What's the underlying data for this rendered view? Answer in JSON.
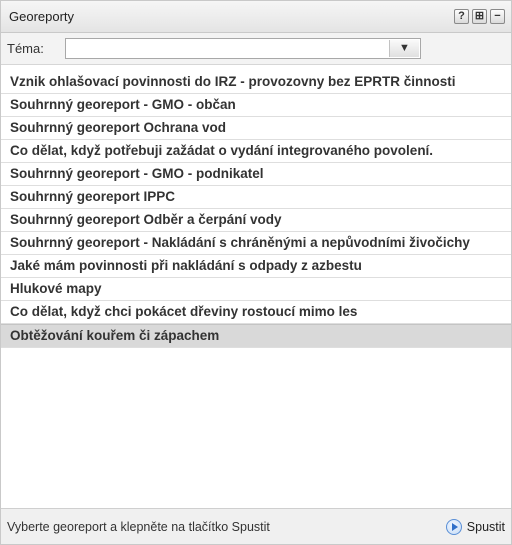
{
  "header": {
    "title": "Georeporty",
    "help": "?",
    "pin": "⊞",
    "collapse": "−"
  },
  "filter": {
    "label": "Téma:",
    "value": ""
  },
  "items": [
    "Vznik ohlašovací povinnosti do IRZ - provozovny bez EPRTR činnosti",
    "Souhrnný georeport - GMO - občan",
    "Souhrnný georeport Ochrana vod",
    "Co dělat, když potřebuji zažádat o vydání integrovaného povolení.",
    "Souhrnný georeport - GMO - podnikatel",
    "Souhrnný georeport IPPC",
    "Souhrnný georeport Odběr a čerpání vody",
    "Souhrnný georeport - Nakládání s chráněnými a nepůvodními živočichy",
    "Jaké mám povinnosti při nakládání s odpady z azbestu",
    "Hlukové mapy",
    "Co dělat, když chci pokácet dřeviny rostoucí mimo les",
    "Obtěžování kouřem či zápachem"
  ],
  "selected_index": 11,
  "footer": {
    "hint": "Vyberte georeport a klepněte na tlačítko Spustit",
    "run_label": "Spustit"
  }
}
